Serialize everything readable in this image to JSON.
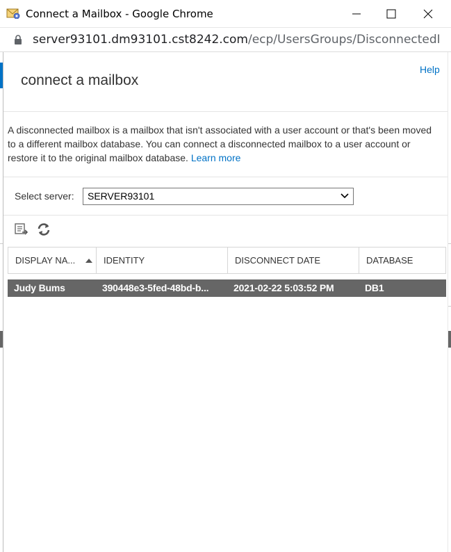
{
  "window": {
    "title": "Connect a Mailbox - Google Chrome",
    "url_host": "server93101.dm93101.cst8242.com",
    "url_path": "/ecp/UsersGroups/DisconnectedMailb..."
  },
  "dialog": {
    "help_label": "Help",
    "title": "connect a mailbox",
    "description": "A disconnected mailbox is a mailbox that isn't associated with a user account or that's been moved to a different mailbox database. You can connect a disconnected mailbox to a user account or restore it to the original mailbox database.",
    "learn_more": "Learn more",
    "server_label": "Select server:",
    "server_value": "SERVER93101"
  },
  "toolbar": {
    "icons": [
      "connect-mailbox-icon",
      "refresh-icon"
    ]
  },
  "grid": {
    "columns": [
      "DISPLAY NA...",
      "IDENTITY",
      "DISCONNECT DATE",
      "DATABASE"
    ],
    "rows": [
      {
        "display_name": "Judy Bums",
        "identity": "390448e3-5fed-48bd-b...",
        "disconnect_date": "2021-02-22 5:03:52 PM",
        "database": "DB1"
      }
    ]
  },
  "colors": {
    "accent": "#0072c6",
    "selected_row": "#666666"
  }
}
